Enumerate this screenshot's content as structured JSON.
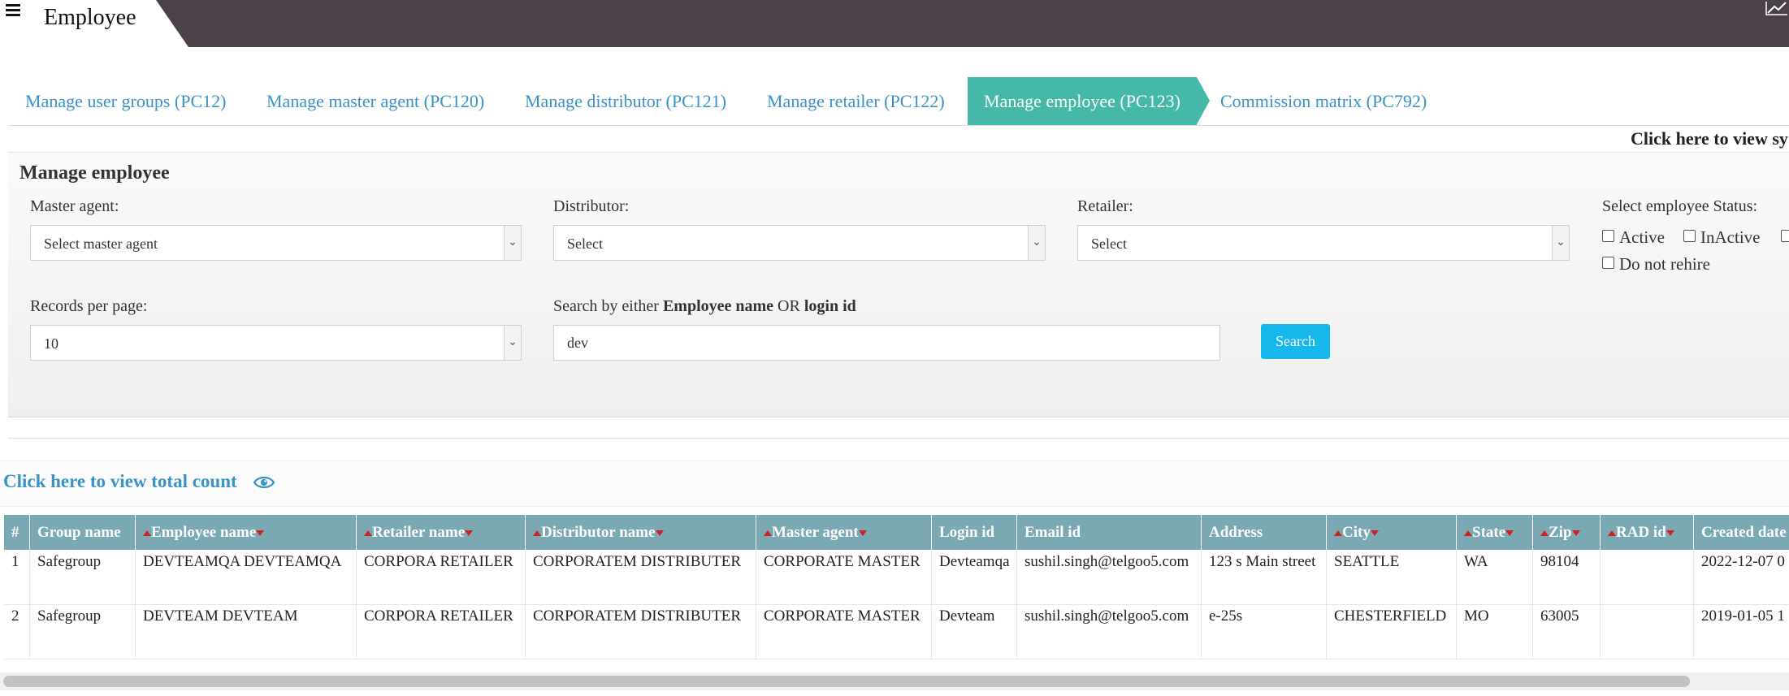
{
  "header": {
    "title": "Employee",
    "menu_icon": "hamburger-menu-icon",
    "chart_icon": "line-chart-icon"
  },
  "tabs": [
    {
      "label": "Manage user groups (PC12)",
      "active": false
    },
    {
      "label": "Manage master agent (PC120)",
      "active": false
    },
    {
      "label": "Manage distributor (PC121)",
      "active": false
    },
    {
      "label": "Manage retailer (PC122)",
      "active": false
    },
    {
      "label": "Manage employee (PC123)",
      "active": true
    },
    {
      "label": "Commission matrix (PC792)",
      "active": false
    }
  ],
  "sys_link": "Click here to view sy",
  "panel": {
    "title": "Manage employee",
    "master_agent": {
      "label": "Master agent:",
      "value": "Select master agent"
    },
    "distributor": {
      "label": "Distributor:",
      "value": "Select"
    },
    "retailer": {
      "label": "Retailer:",
      "value": "Select"
    },
    "status": {
      "label": "Select employee Status:",
      "options": [
        "Active",
        "InActive",
        "Do not rehire"
      ]
    },
    "records_per_page": {
      "label": "Records per page:",
      "value": "10"
    },
    "search": {
      "label_prefix": "Search by either ",
      "label_bold1": "Employee name",
      "label_mid": " OR ",
      "label_bold2": "login id",
      "value": "dev",
      "button": "Search"
    }
  },
  "count_link": "Click here to view total count",
  "table": {
    "columns": [
      "#",
      "Group name",
      "Employee name",
      "Retailer name",
      "Distributor name",
      "Master agent",
      "Login id",
      "Email id",
      "Address",
      "City",
      "State",
      "Zip",
      "RAD id",
      "Created date"
    ],
    "rows": [
      [
        "1",
        "Safegroup",
        "DEVTEAMQA DEVTEAMQA",
        "CORPORA RETAILER",
        "CORPORATEM DISTRIBUTER",
        "CORPORATE MASTER",
        "Devteamqa",
        "sushil.singh@telgoo5.com",
        "123 s Main street",
        "SEATTLE",
        "WA",
        "98104",
        "",
        "2022-12-07 0"
      ],
      [
        "2",
        "Safegroup",
        "DEVTEAM DEVTEAM",
        "CORPORA RETAILER",
        "CORPORATEM DISTRIBUTER",
        "CORPORATE MASTER",
        "Devteam",
        "sushil.singh@telgoo5.com",
        "e-25s",
        "CHESTERFIELD",
        "MO",
        "63005",
        "",
        "2019-01-05 1"
      ]
    ]
  },
  "colors": {
    "topbar": "#4a4149",
    "active_tab": "#45b8a8",
    "link": "#3a93c5",
    "table_header": "#7aa9b4",
    "search_button": "#16b7ea",
    "sort_arrow": "#d21f1f"
  }
}
